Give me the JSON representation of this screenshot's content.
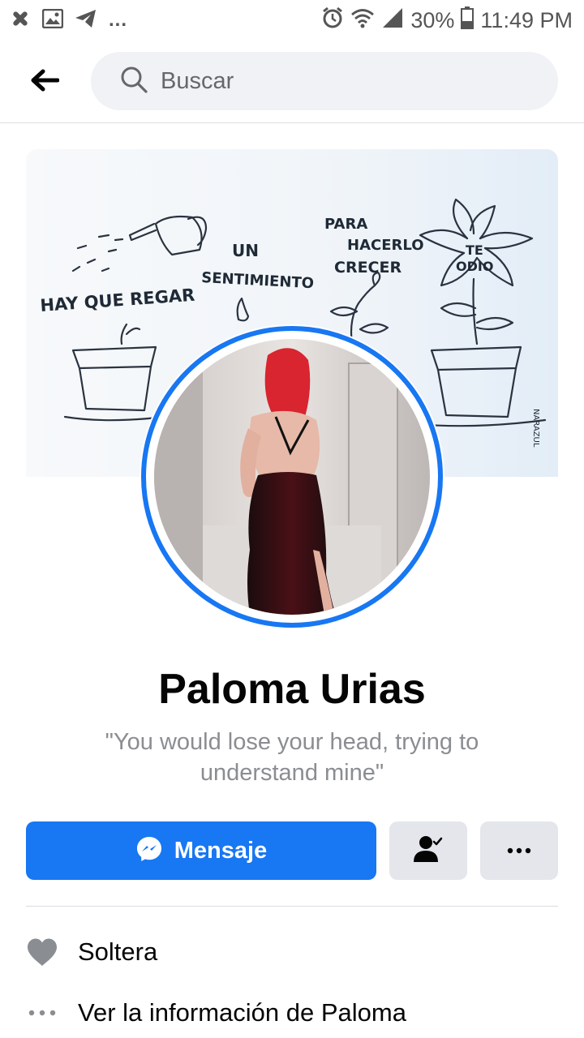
{
  "status_bar": {
    "notification_icons": [
      "slack-icon",
      "image-icon",
      "telegram-icon"
    ],
    "overflow": "...",
    "battery": "30%",
    "time": "11:49 PM"
  },
  "top_nav": {
    "search_placeholder": "Buscar"
  },
  "cover": {
    "texts": [
      "HAY QUE REGAR",
      "UN",
      "SENTIMIENTO",
      "PARA",
      "HACERLO",
      "CRECER",
      "TE",
      "ODIO",
      "NARAZUL"
    ]
  },
  "profile": {
    "name": "Paloma Urias",
    "bio": "\"You would lose your head, trying to understand mine\""
  },
  "actions": {
    "message_label": "Mensaje"
  },
  "info": {
    "relationship": "Soltera",
    "about_link": "Ver la información de Paloma"
  },
  "colors": {
    "accent": "#1877f2",
    "secondary_button": "#e4e6eb",
    "search_bg": "#f0f2f5",
    "muted_text": "#8a8d91"
  }
}
